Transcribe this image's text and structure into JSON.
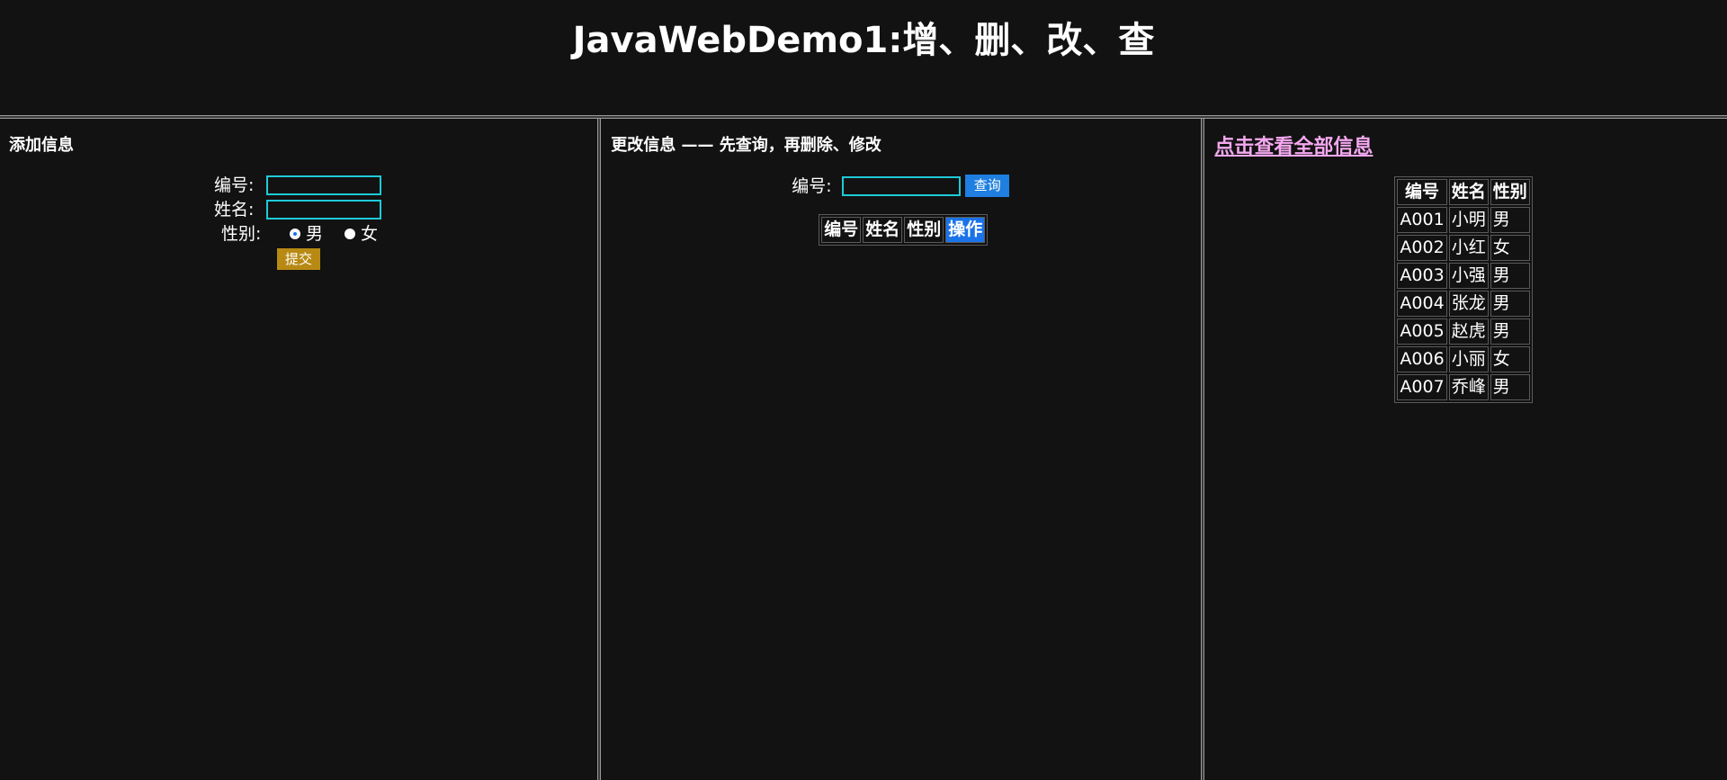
{
  "header": {
    "title": "JavaWebDemo1:增、删、改、查"
  },
  "add_panel": {
    "title": "添加信息",
    "id_label": "编号:",
    "name_label": "姓名:",
    "gender_label": "性别:",
    "gender_options": [
      "男",
      "女"
    ],
    "gender_selected": "男",
    "id_value": "",
    "name_value": "",
    "submit_label": "提交"
  },
  "edit_panel": {
    "title": "更改信息 —— 先查询，再删除、修改",
    "id_label": "编号:",
    "id_value": "",
    "query_label": "查询",
    "table_headers": [
      "编号",
      "姓名",
      "性别",
      "操作"
    ]
  },
  "list_panel": {
    "link_text": "点击查看全部信息",
    "link_color": "#f5a8f0",
    "table_headers": [
      "编号",
      "姓名",
      "性别"
    ],
    "rows": [
      [
        "A001",
        "小明",
        "男"
      ],
      [
        "A002",
        "小红",
        "女"
      ],
      [
        "A003",
        "小强",
        "男"
      ],
      [
        "A004",
        "张龙",
        "男"
      ],
      [
        "A005",
        "赵虎",
        "男"
      ],
      [
        "A006",
        "小丽",
        "女"
      ],
      [
        "A007",
        "乔峰",
        "男"
      ]
    ]
  },
  "colors": {
    "background": "#121212",
    "input_border": "#1ecbd8",
    "submit_button": "#b88a14",
    "query_button": "#1e7fe0",
    "highlight": "#1a73e8"
  }
}
